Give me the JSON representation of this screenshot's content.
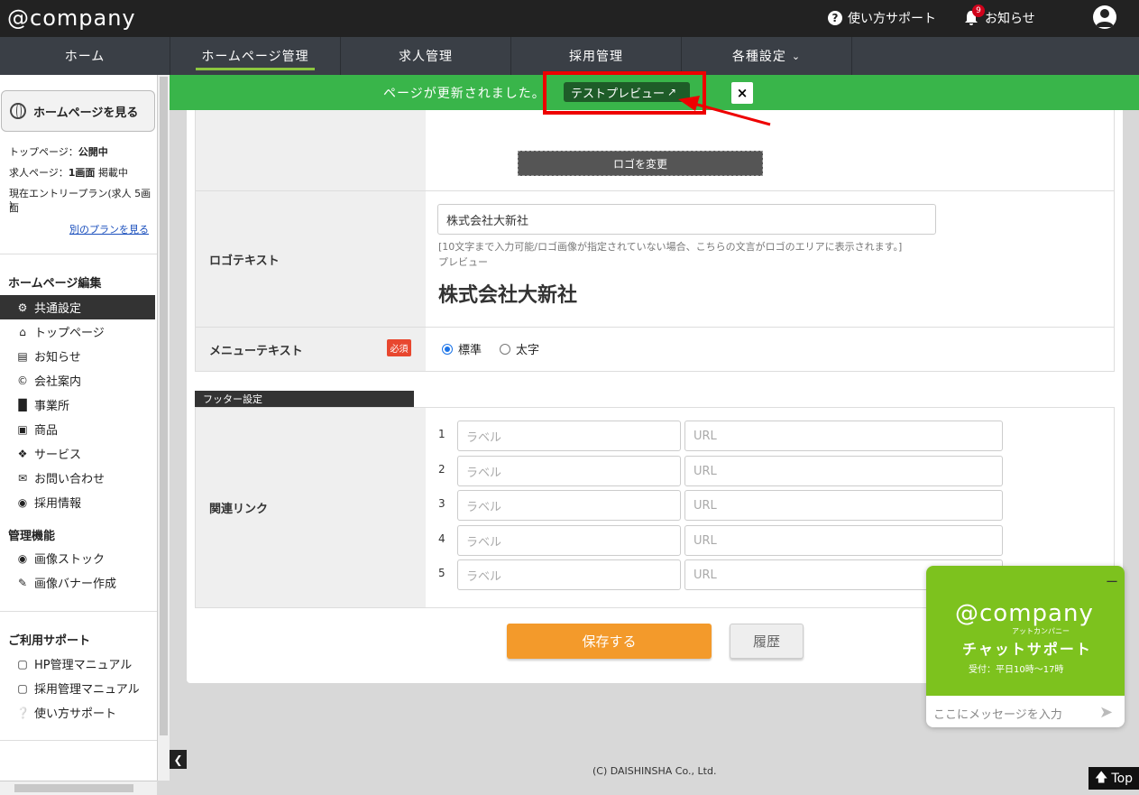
{
  "app": {
    "logo": "@company",
    "support_label": "使い方サポート",
    "news_label": "お知らせ",
    "news_count": "9"
  },
  "nav": {
    "tabs": [
      {
        "label": "ホーム"
      },
      {
        "label": "ホームページ管理",
        "active": true
      },
      {
        "label": "求人管理"
      },
      {
        "label": "採用管理"
      },
      {
        "label": "各種設定"
      }
    ]
  },
  "notice": {
    "message": "ページが更新されました。",
    "preview_button": "テストプレビュー",
    "close": "×"
  },
  "sidebar": {
    "view_site": "ホームページを見る",
    "top_page_label": "トップページ：",
    "top_page_status": "公開中",
    "job_page_label": "求人ページ：",
    "job_page_status": "1画面",
    "job_page_suffix": "掲載中",
    "plan_line1": "現在エントリープラン(求人 5画面",
    "plan_line2": ")",
    "other_plan": "別のプランを見る",
    "section_edit": "ホームページ編集",
    "edit_items": [
      {
        "label": "共通設定",
        "icon": "gear-icon",
        "active": true
      },
      {
        "label": "トップページ",
        "icon": "home-icon"
      },
      {
        "label": "お知らせ",
        "icon": "news-icon"
      },
      {
        "label": "会社案内",
        "icon": "copyright-icon"
      },
      {
        "label": "事業所",
        "icon": "factory-icon"
      },
      {
        "label": "商品",
        "icon": "cube-icon"
      },
      {
        "label": "サービス",
        "icon": "handshake-icon"
      },
      {
        "label": "お問い合わせ",
        "icon": "envelope-icon"
      },
      {
        "label": "採用情報",
        "icon": "user-circle-icon"
      }
    ],
    "section_admin": "管理機能",
    "admin_items": [
      {
        "label": "画像ストック",
        "icon": "camera-icon"
      },
      {
        "label": "画像バナー作成",
        "icon": "pencil-icon"
      }
    ],
    "section_support": "ご利用サポート",
    "support_items": [
      {
        "label": "HP管理マニュアル",
        "icon": "pdf-icon"
      },
      {
        "label": "採用管理マニュアル",
        "icon": "pdf-icon"
      },
      {
        "label": "使い方サポート",
        "icon": "question-icon"
      }
    ]
  },
  "form": {
    "change_logo_button": "ロゴを変更",
    "logo_text_label": "ロゴテキスト",
    "logo_text_value": "株式会社大新社",
    "logo_text_hint": "[10文字まで入力可能/ロゴ画像が指定されていない場合、こちらの文言がロゴのエリアに表示されます。]",
    "preview_label": "プレビュー",
    "preview_value": "株式会社大新社",
    "menu_text_label": "メニューテキスト",
    "required_badge": "必須",
    "radio_standard": "標準",
    "radio_bold": "太字",
    "footer_section": "フッター設定",
    "related_links_label": "関連リンク",
    "links": [
      {
        "num": "1",
        "label_placeholder": "ラベル",
        "url_placeholder": "URL"
      },
      {
        "num": "2",
        "label_placeholder": "ラベル",
        "url_placeholder": "URL"
      },
      {
        "num": "3",
        "label_placeholder": "ラベル",
        "url_placeholder": "URL"
      },
      {
        "num": "4",
        "label_placeholder": "ラベル",
        "url_placeholder": "URL"
      },
      {
        "num": "5",
        "label_placeholder": "ラベル",
        "url_placeholder": "URL"
      }
    ],
    "save_button": "保存する",
    "history_button": "履歴"
  },
  "footer": {
    "copyright": "(C) DAISHINSHA Co., Ltd.",
    "top_button": "Top"
  },
  "chat": {
    "logo": "@company",
    "sub": "アットカンパニー",
    "title": "チャットサポート",
    "hours": "受付：平日10時～17時",
    "input_placeholder": "ここにメッセージを入力",
    "minimize": "ー"
  },
  "colors": {
    "topbar": "#222222",
    "nav": "#3a3f46",
    "accent_green": "#39b54a",
    "save_orange": "#f39a2b",
    "chat_green": "#7dc21e",
    "highlight_red": "#ee0000"
  }
}
